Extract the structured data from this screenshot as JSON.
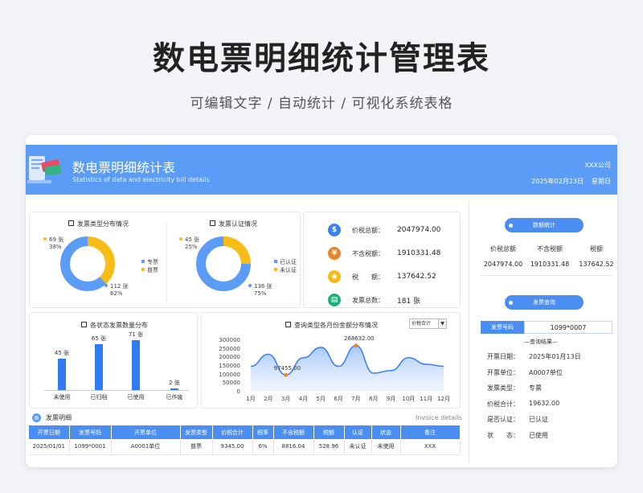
{
  "hero": {
    "title": "数电票明细统计管理表",
    "subtitle": "可编辑文字 / 自动统计 / 可视化系统表格"
  },
  "header": {
    "title": "数电票明细统计表",
    "subtitle": "Statistics of data and electricity bill details",
    "company": "XXX公司",
    "date": "2025年02月23日",
    "weekday": "星期日"
  },
  "colors": {
    "primary": "#5b9cf7",
    "accent_blue": "#2f7cf2",
    "yellow": "#f7bc17",
    "dark_blue": "#4a8ef3"
  },
  "invoice_type_panel": {
    "title": "发票类型分布情况",
    "slices": [
      {
        "name": "专票",
        "count": "112 张",
        "pct": "62%",
        "value": 0.62,
        "color": "#5b9cf7"
      },
      {
        "name": "普票",
        "count": "69 张",
        "pct": "38%",
        "value": 0.38,
        "color": "#f7bc17"
      }
    ]
  },
  "cert_panel": {
    "title": "发票认证情况",
    "slices": [
      {
        "name": "已认证",
        "count": "136 张",
        "pct": "75%",
        "value": 0.75,
        "color": "#5b9cf7"
      },
      {
        "name": "未认证",
        "count": "45 张",
        "pct": "25%",
        "value": 0.25,
        "color": "#f7bc17"
      }
    ]
  },
  "stats": [
    {
      "icon": "$",
      "color": "#3b82f0",
      "label": "价税总额：",
      "value": "2047974.00"
    },
    {
      "icon": "¥",
      "color": "#e8842a",
      "label": "不含税额：",
      "value": "1910331.48"
    },
    {
      "icon": "◆",
      "color": "#f7bc17",
      "label": "税　　额：",
      "value": "137642.52"
    },
    {
      "icon": "▤",
      "color": "#22b07a",
      "label": "发票总数：",
      "value": "181 张"
    }
  ],
  "status_panel": {
    "title": "各状态发票数量分布",
    "chart_data": {
      "type": "bar",
      "categories": [
        "未使用",
        "已归档",
        "已使用",
        "已作废"
      ],
      "values": [
        45,
        65,
        71,
        2
      ],
      "value_labels": [
        "45 张",
        "65 张",
        "71 张",
        "2 张"
      ]
    }
  },
  "monthly_panel": {
    "title": "查询类型各月份金额分布情况",
    "select_value": "价税合计",
    "chart_data": {
      "type": "area",
      "categories": [
        "1月",
        "2月",
        "3月",
        "4月",
        "5月",
        "6月",
        "7月",
        "8月",
        "9月",
        "10月",
        "11月",
        "12月"
      ],
      "values": [
        148000,
        218000,
        97455,
        198000,
        258000,
        148000,
        268632,
        108000,
        123000,
        198000,
        160000,
        148000
      ],
      "ylim": [
        0,
        300000
      ],
      "yticks": [
        "300000",
        "250000",
        "200000",
        "150000",
        "100000",
        "50000",
        "0"
      ],
      "annotations": [
        {
          "index": 2,
          "label": "97455.00"
        },
        {
          "index": 6,
          "label": "268632.00"
        }
      ]
    }
  },
  "detail_table": {
    "title": "发票明细",
    "title_en": "Invoice details",
    "headers": [
      "开票日期",
      "发票号码",
      "开票单位",
      "发票类型",
      "价税合计",
      "税率",
      "不含税额",
      "税额",
      "认证",
      "状态",
      "备注"
    ],
    "rows": [
      [
        "2025/01/01",
        "1099*0001",
        "A0001单位",
        "普票",
        "9345.00",
        "6%",
        "8816.04",
        "528.96",
        "未认证",
        "未使用",
        "XXX"
      ]
    ]
  },
  "summary": {
    "title": "数额统计",
    "headers": [
      "价税总额",
      "不含税额",
      "税额"
    ],
    "values": [
      "2047974.00",
      "1910331.48",
      "137642.52"
    ]
  },
  "query": {
    "title": "发票查询",
    "label": "发票号码",
    "value": "1099*0007",
    "result_title": "—查询结果—",
    "fields": [
      {
        "key": "开票日期：",
        "value": "2025年01月13日"
      },
      {
        "key": "开票单位：",
        "value": "A0007单位"
      },
      {
        "key": "发票类型：",
        "value": "专票"
      },
      {
        "key": "价税合计：",
        "value": "19632.00"
      },
      {
        "key": "是否认证：",
        "value": "已认证"
      },
      {
        "key": "状　　态：",
        "value": "已使用"
      }
    ]
  }
}
